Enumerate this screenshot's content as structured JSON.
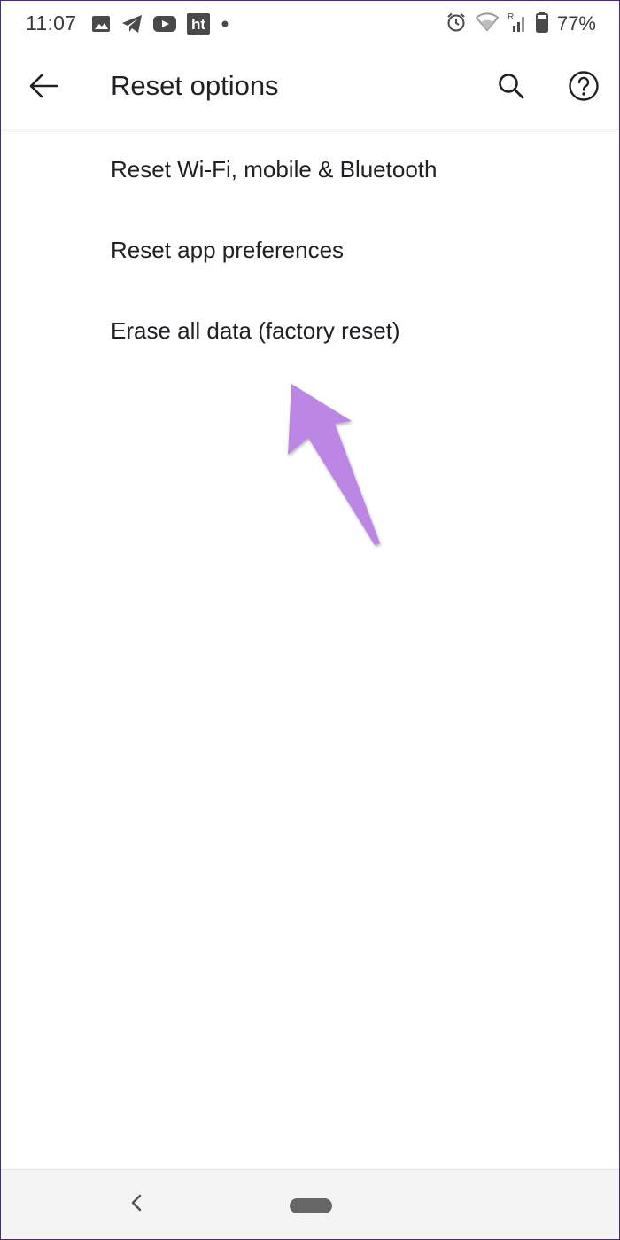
{
  "status_bar": {
    "time": "11:07",
    "battery_percent": "77%",
    "left_icons": [
      "gallery-icon",
      "telegram-icon",
      "youtube-icon",
      "ht-app-icon",
      "notification-dot-icon"
    ],
    "right_icons": [
      "alarm-icon",
      "wifi-icon",
      "signal-roaming-icon",
      "battery-icon"
    ],
    "ht_badge": "ht"
  },
  "app_bar": {
    "title": "Reset options",
    "back_icon": "arrow-back-icon",
    "search_icon": "search-icon",
    "help_icon": "help-icon"
  },
  "options": [
    {
      "label": "Reset Wi-Fi, mobile & Bluetooth"
    },
    {
      "label": "Reset app preferences"
    },
    {
      "label": "Erase all data (factory reset)"
    }
  ],
  "annotation": {
    "arrow_color": "#bb86e4",
    "arrow_icon": "annotation-arrow-icon"
  },
  "nav_bar": {
    "back_icon": "nav-back-icon",
    "home_icon": "nav-home-pill-icon"
  }
}
